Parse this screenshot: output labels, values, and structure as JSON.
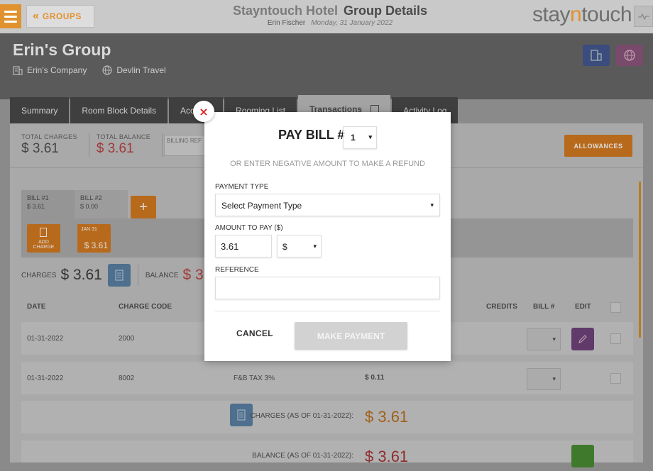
{
  "header": {
    "back_label": "GROUPS",
    "hotel_name": "Stayntouch Hotel",
    "page_title": "Group Details",
    "user_name": "Erin Fischer",
    "date": "Monday, 31 January 2022",
    "brand_left": "stay",
    "brand_mid": "n",
    "brand_right": "touch"
  },
  "group": {
    "name": "Erin's Group",
    "company": "Erin's Company",
    "travel_agent": "Devlin Travel"
  },
  "tabs": [
    {
      "label": "Summary"
    },
    {
      "label": "Room Block Details"
    },
    {
      "label": "Acc"
    },
    {
      "label": "Rooming List"
    },
    {
      "label": "Transactions"
    },
    {
      "label": "Activity Log"
    }
  ],
  "totals": {
    "total_charges_label": "TOTAL CHARGES",
    "total_charges_value": "$ 3.61",
    "total_balance_label": "TOTAL BALANCE",
    "total_balance_value": "$ 3.61",
    "billing_ref_label": "BILLING REF",
    "allowances_label": "ALLOWANCES"
  },
  "bills": [
    {
      "label": "BILL #1",
      "amount": "$ 3.61"
    },
    {
      "label": "BILL #2",
      "amount": "$ 0.00"
    }
  ],
  "add_bill_label": "+",
  "add_charge_label_1": "ADD",
  "add_charge_label_2": "CHARGE",
  "date_card": {
    "date": "JAN 31",
    "amount": "$ 3.61"
  },
  "summary_row": {
    "charges_label": "CHARGES",
    "charges_value": "$ 3.61",
    "balance_label": "BALANCE",
    "balance_value": "$ 3.6"
  },
  "table": {
    "headers": {
      "date": "DATE",
      "charge_code": "CHARGE CODE",
      "credits": "CREDITS",
      "bill": "BILL #",
      "edit": "EDIT"
    },
    "rows": [
      {
        "date": "01-31-2022",
        "code": "2000",
        "desc": "",
        "amount": ""
      },
      {
        "date": "01-31-2022",
        "code": "8002",
        "desc": "F&B TAX 3%",
        "amount": "$ 0.11"
      }
    ],
    "charges_as_of_label": "CHARGES (AS OF 01-31-2022):",
    "charges_as_of_value": "$ 3.61",
    "balance_as_of_label": "BALANCE (AS OF 01-31-2022):",
    "balance_as_of_value": "$ 3.61"
  },
  "modal": {
    "close_label": "×",
    "title": "PAY BILL #",
    "bill_number": "1",
    "hint": "OR ENTER NEGATIVE AMOUNT TO MAKE A REFUND",
    "payment_type_label": "PAYMENT TYPE",
    "payment_type_value": "Select Payment Type",
    "amount_label": "AMOUNT TO PAY ($)",
    "amount_value": "3.61",
    "currency_value": "$",
    "reference_label": "REFERENCE",
    "reference_value": "",
    "cancel_label": "CANCEL",
    "make_payment_label": "MAKE PAYMENT"
  }
}
